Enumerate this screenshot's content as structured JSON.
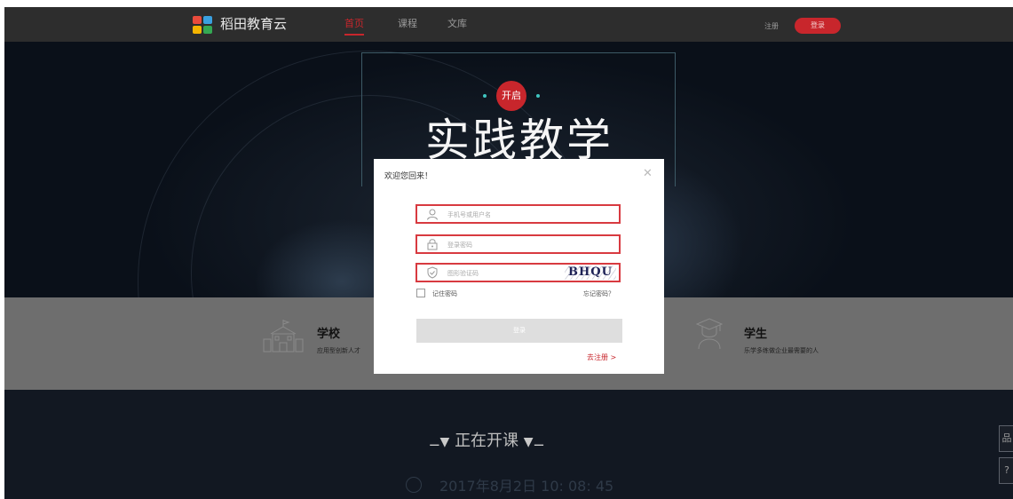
{
  "nav": {
    "brand": "稻田教育云",
    "items": [
      {
        "label": "首页",
        "active": true
      },
      {
        "label": "课程",
        "active": false
      },
      {
        "label": "文库",
        "active": false
      }
    ],
    "register_label": "注册",
    "login_label": "登录",
    "logo_colors": [
      "#e94b3c",
      "#3aa0e0",
      "#f4b400",
      "#34a853"
    ]
  },
  "hero": {
    "badge": "开启",
    "title": "实践教学"
  },
  "roles": [
    {
      "title": "学校",
      "desc": "应用型创新人才"
    },
    {
      "title": "学生",
      "desc": "乐学多练做企业最需要的人"
    }
  ],
  "live": {
    "title": "正在开课",
    "datetime": "2017年8月2日 10: 08: 45"
  },
  "side": [
    "品",
    "?"
  ],
  "modal": {
    "title": "欢迎您回来！",
    "username_placeholder": "手机号或用户名",
    "password_placeholder": "登录密码",
    "captcha_placeholder": "图形验证码",
    "captcha_text": "BHQU",
    "remember_label": "记住密码",
    "forgot_label": "忘记密码？",
    "submit_label": "登录",
    "register_link": "去注册 >"
  },
  "colors": {
    "accent": "#c8262c",
    "nav_bg": "#2d2d2d",
    "field_border": "#d83a40"
  }
}
